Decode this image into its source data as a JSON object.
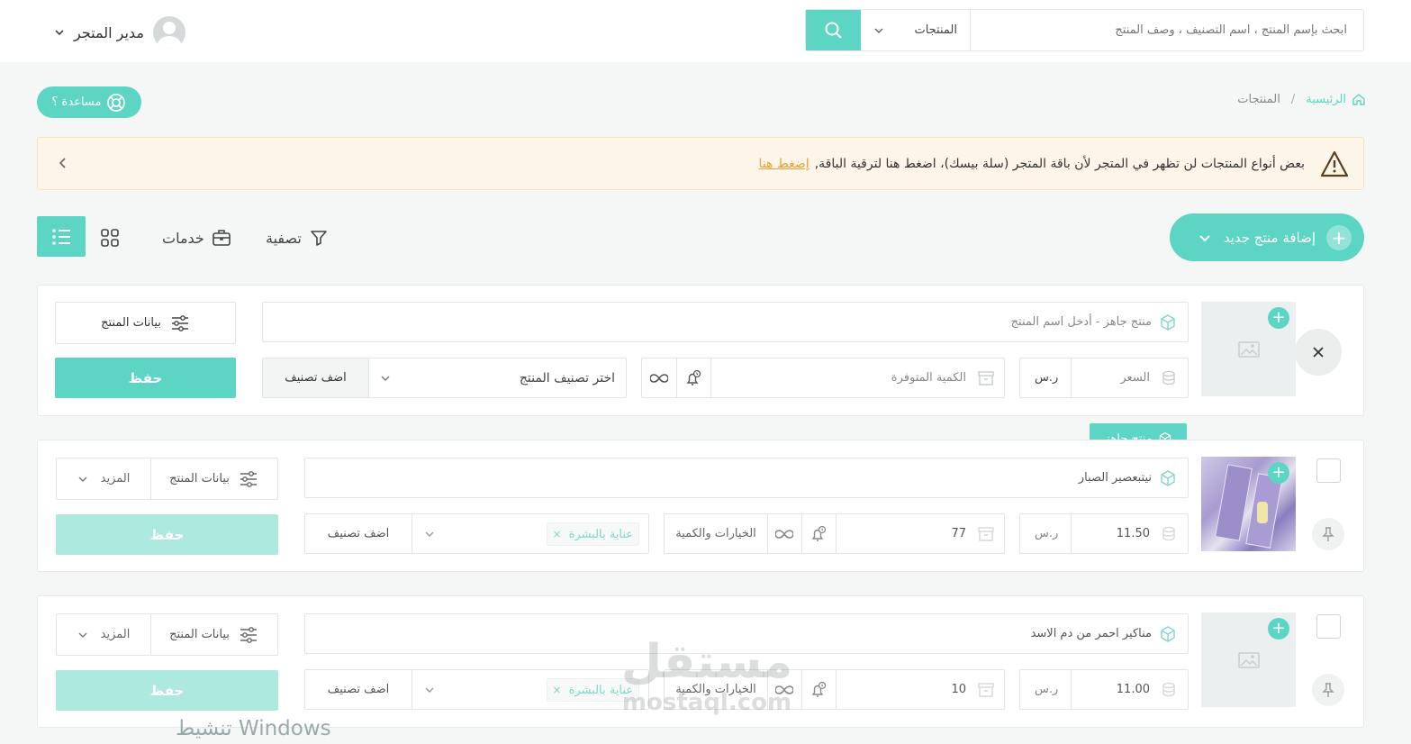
{
  "header": {
    "user_name": "مدير المتجر",
    "search_placeholder": "ابحث بإسم المنتج ، اسم التصنيف ، وصف المنتج",
    "search_scope": "المنتجات"
  },
  "help_label": "مساعدة ؟",
  "breadcrumb": {
    "home": "الرئيسية",
    "separator": "/",
    "current": "المنتجات"
  },
  "alert": {
    "text": "بعض أنواع المنتجات لن تظهر في المتجر لأن باقة المتجر (سلة بيسك)، اضغط هنا لترقية الباقة,",
    "link": "إضغط هنا"
  },
  "toolbar": {
    "add_product": "إضافة منتج جديد",
    "filter": "تصفية",
    "services": "خدمات"
  },
  "new_product": {
    "name_placeholder": "منتج جاهز - أدخل اسم المنتج",
    "product_data": "بيانات المنتج",
    "save": "حفظ",
    "price_placeholder": "السعر",
    "currency": "ر.س",
    "qty_placeholder": "الكمية المتوفرة",
    "category_placeholder": "اختر تصنيف المنتج",
    "add_category": "اضف تصنيف"
  },
  "tooltip": "منتج جاهز",
  "products": [
    {
      "name": "نيتبعصير الصبار",
      "price": "11.50",
      "currency": "ر.س",
      "qty": "77",
      "options": "الخيارات والكمية",
      "tag": "عناية بالبشرة",
      "add_category": "اضف تصنيف",
      "product_data": "بيانات المنتج",
      "more": "المزيد",
      "save": "حفظ"
    },
    {
      "name": "مناكير احمر من دم الاسد",
      "price": "11.00",
      "currency": "ر.س",
      "qty": "10",
      "options": "الخيارات والكمية",
      "tag": "عناية بالبشرة",
      "add_category": "اضف تصنيف",
      "product_data": "بيانات المنتج",
      "more": "المزيد",
      "save": "حفظ"
    }
  ],
  "watermark": {
    "windows": "تنشيط Windows",
    "brand_ar": "مستقل",
    "brand_en": "mostaql.com"
  },
  "colors": {
    "accent": "#5dd5c4",
    "accent_light": "#aee9e0",
    "alert_bg": "#fdf5e8",
    "link": "#e6a23c"
  }
}
